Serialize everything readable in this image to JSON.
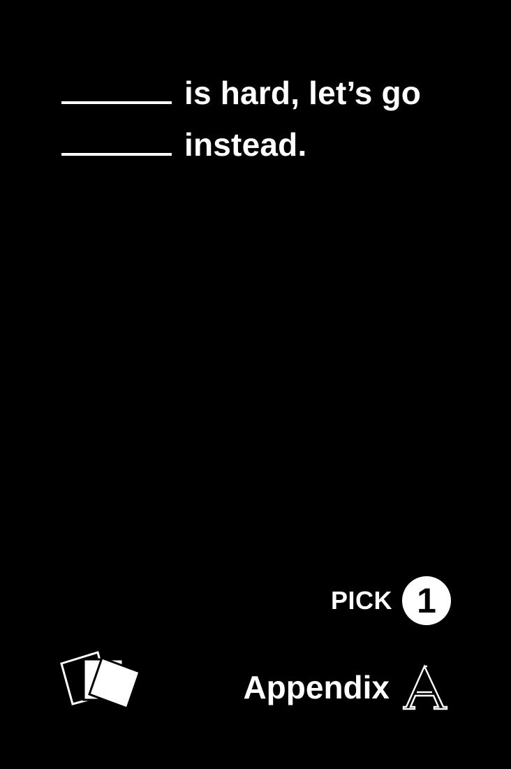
{
  "card": {
    "background": "#000000",
    "text_color": "#ffffff",
    "prompt": {
      "blank": "______",
      "line1_text": "is hard, let’s go",
      "line2_text": "instead."
    },
    "pick": {
      "label": "PICK",
      "count": "1"
    },
    "footer": {
      "deck_icon": "cards-stack-icon",
      "brand_name": "Appendix",
      "brand_mark_icon": "outlined-letter-a-icon"
    }
  }
}
